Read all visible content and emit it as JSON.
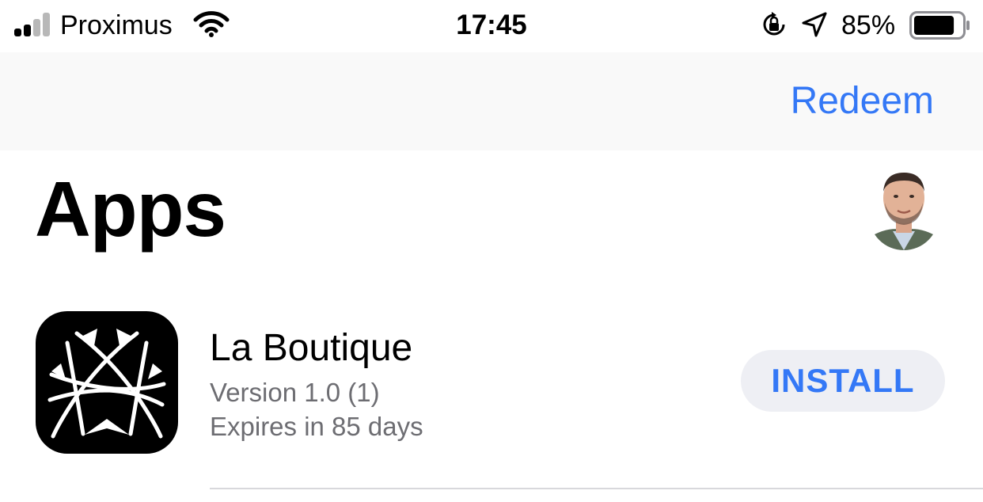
{
  "status_bar": {
    "carrier": "Proximus",
    "time": "17:45",
    "battery_percent": "85%",
    "battery_level": 0.85,
    "signal_bars_filled": 2,
    "signal_bars_total": 4,
    "icons": [
      "signal-icon",
      "wifi-icon",
      "rotation-lock-icon",
      "location-arrow-icon",
      "battery-icon"
    ]
  },
  "nav": {
    "redeem_label": "Redeem"
  },
  "page": {
    "title": "Apps",
    "avatar": "profile-avatar"
  },
  "apps": [
    {
      "name": "La Boutique",
      "version": "Version 1.0 (1)",
      "expiry": "Expires in 85 days",
      "action_label": "INSTALL",
      "icon": "la-boutique-app-icon"
    }
  ],
  "colors": {
    "accent": "#3478f6",
    "secondary_text": "#6d6d72",
    "button_bg": "#eeeff4",
    "nav_bg": "#f9f9f9"
  }
}
